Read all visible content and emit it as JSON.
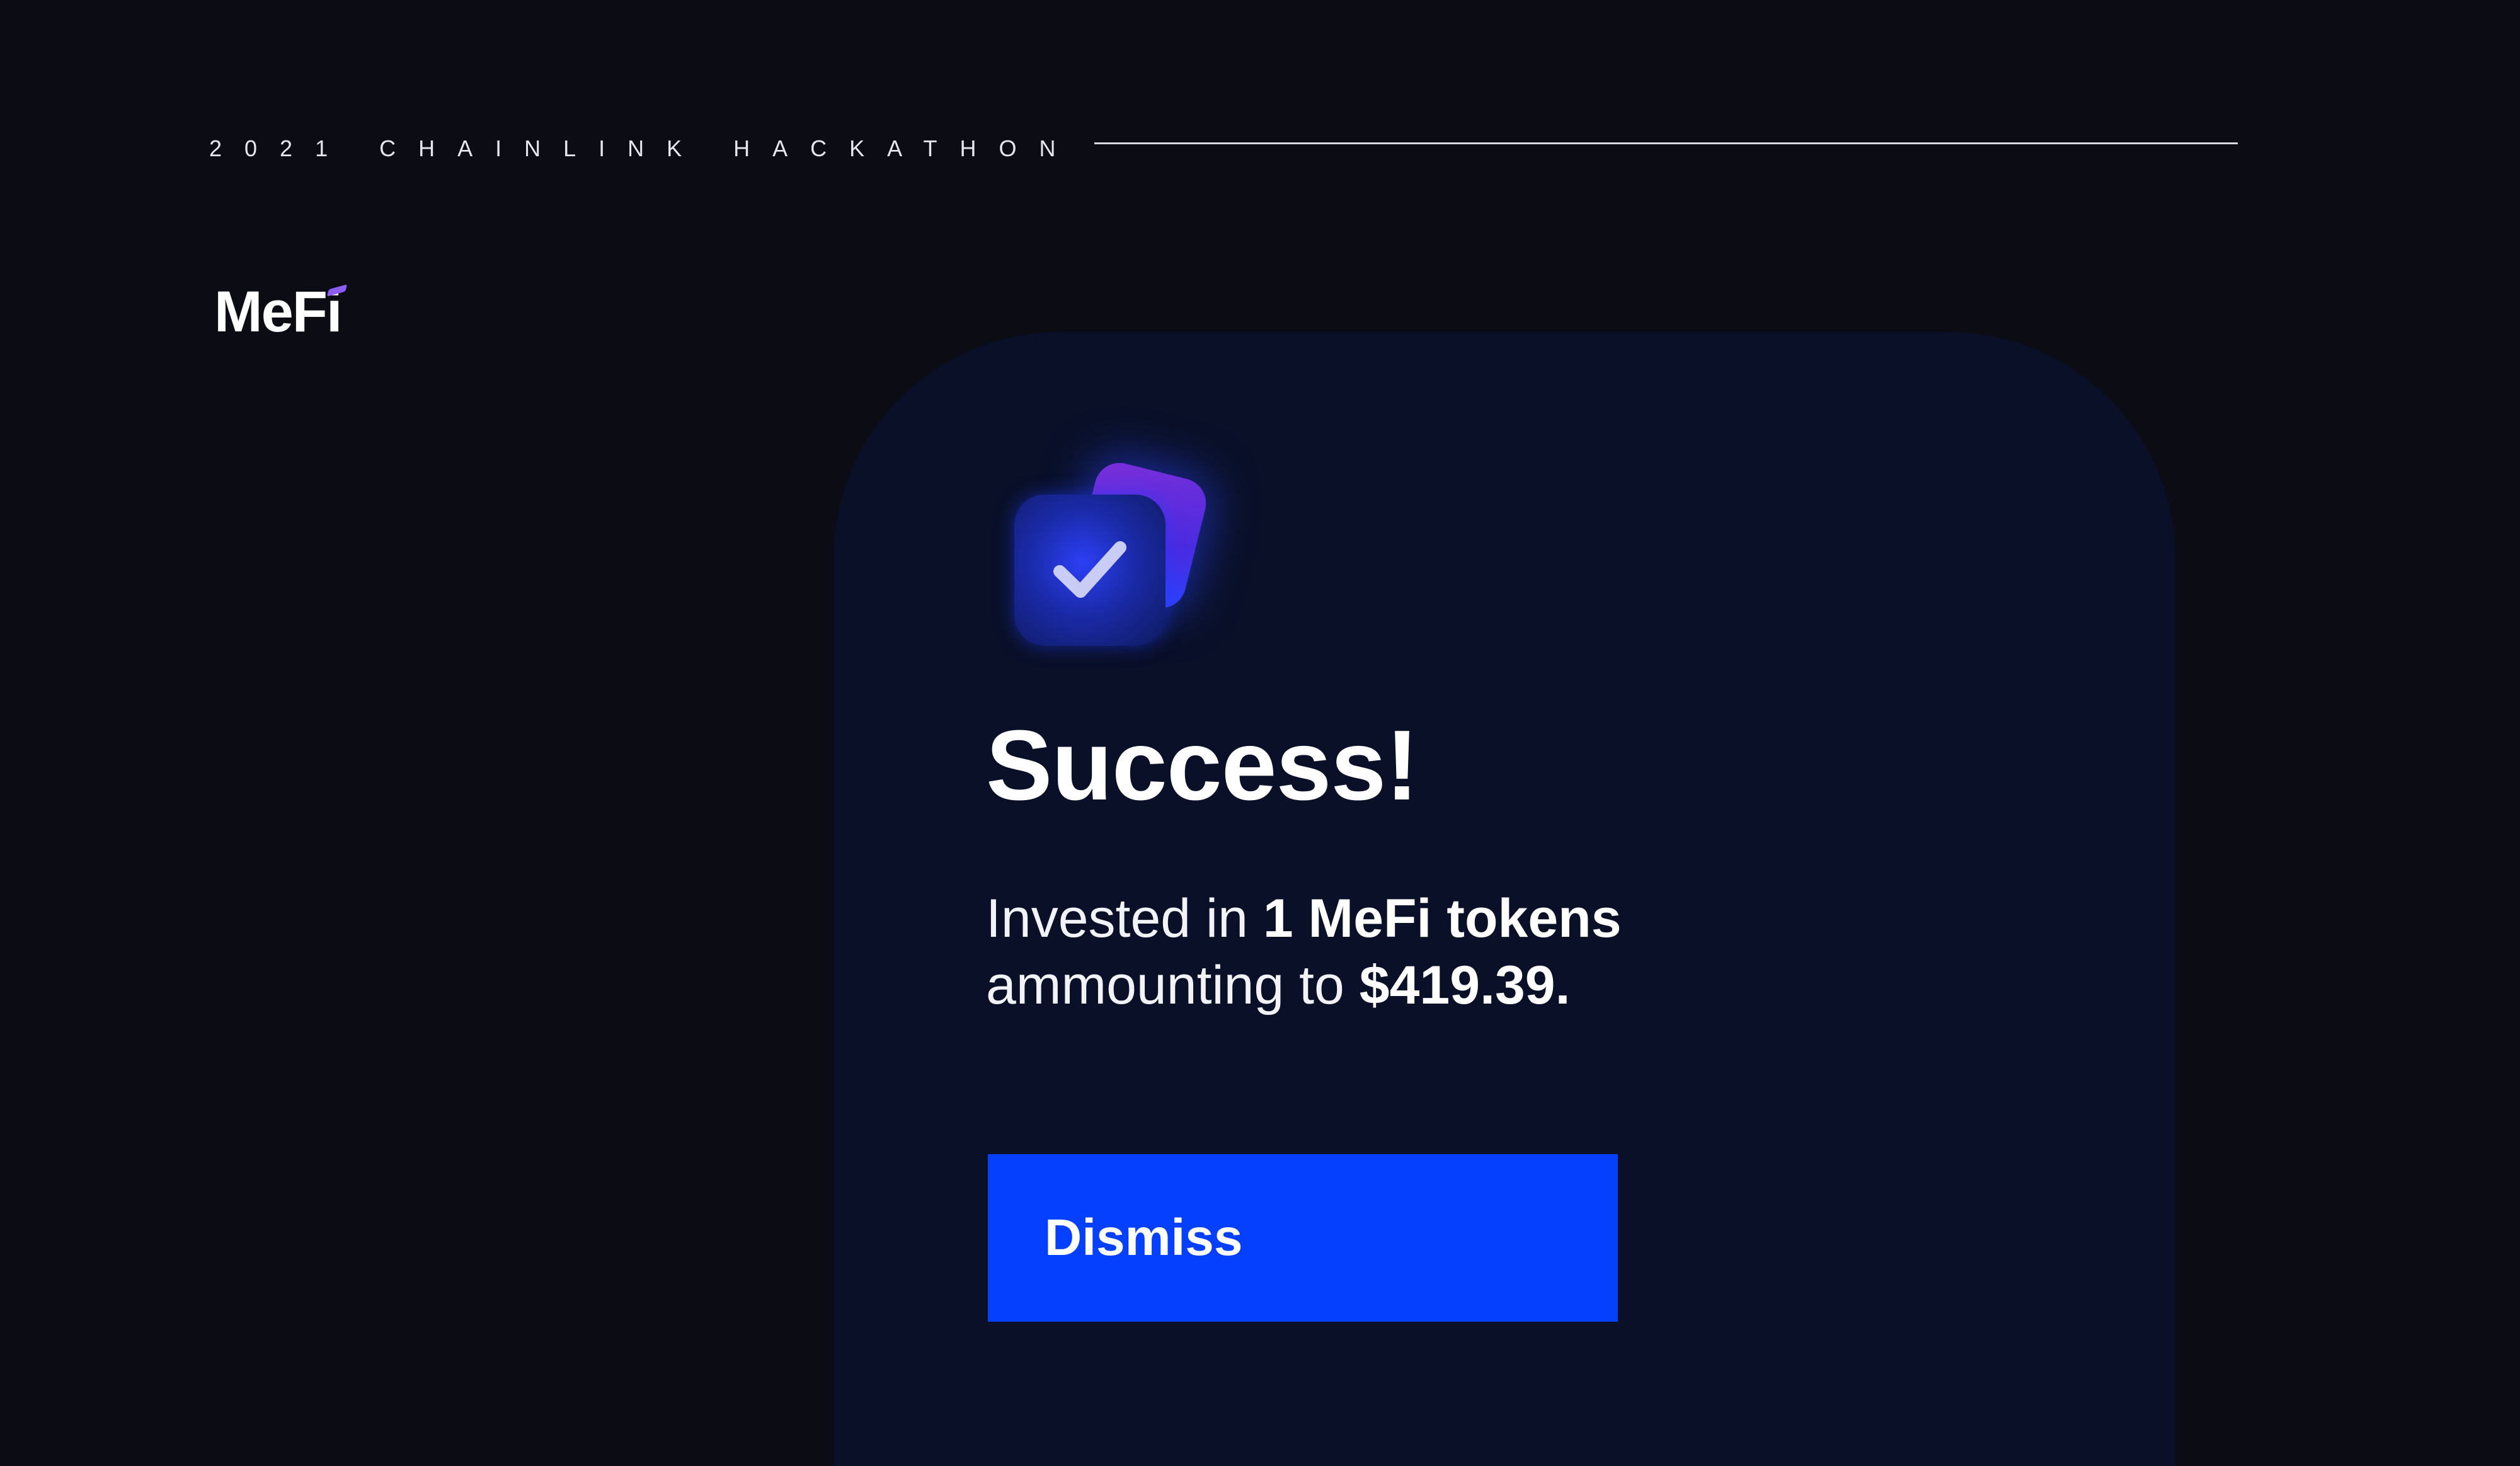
{
  "header": {
    "event_label": "2021 CHAINLINK HACKATHON"
  },
  "brand": {
    "logo_text": "MeFi",
    "accent_color": "#8b5cf6"
  },
  "dialog": {
    "icon": "check-icon",
    "title": "Success!",
    "message": {
      "prefix": "Invested in ",
      "token_amount": "1 MeFi tokens",
      "middle": "ammounting to ",
      "value": "$419.39."
    },
    "dismiss_label": "Dismiss",
    "button_color": "#0540ff",
    "card_color": "#0a1028"
  }
}
